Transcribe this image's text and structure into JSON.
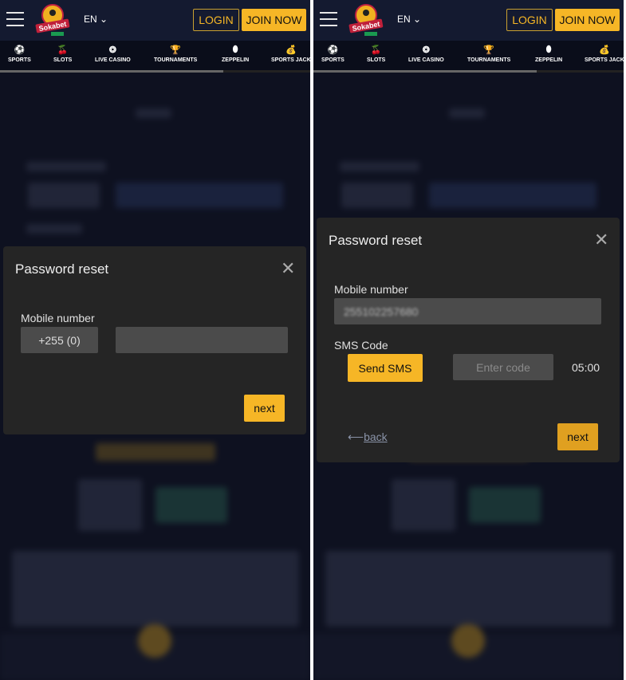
{
  "header": {
    "brand": "Sokabet",
    "lang": "EN",
    "login": "LOGIN",
    "join": "JOIN NOW"
  },
  "nav": [
    {
      "label": "SPORTS",
      "icon": "soccer-ball-icon"
    },
    {
      "label": "SLOTS",
      "icon": "cherries-icon"
    },
    {
      "label": "LIVE CASINO",
      "icon": "roulette-icon"
    },
    {
      "label": "TOURNAMENTS",
      "icon": "trophy-icon"
    },
    {
      "label": "ZEPPELIN",
      "icon": "zeppelin-icon"
    },
    {
      "label": "SPORTS JACK",
      "icon": "money-bag-icon"
    }
  ],
  "left_modal": {
    "title": "Password reset",
    "mobile_label": "Mobile number",
    "prefix": "+255 (0)",
    "phone_value": "",
    "next": "next"
  },
  "right_modal": {
    "title": "Password reset",
    "mobile_label": "Mobile number",
    "phone_value": "255102257680",
    "sms_label": "SMS Code",
    "send_sms": "Send SMS",
    "code_placeholder": "Enter code",
    "timer": "05:00",
    "back": "back",
    "next": "next"
  },
  "colors": {
    "accent": "#f6b626",
    "modal_bg": "#252525",
    "header_bg": "#141a30"
  }
}
